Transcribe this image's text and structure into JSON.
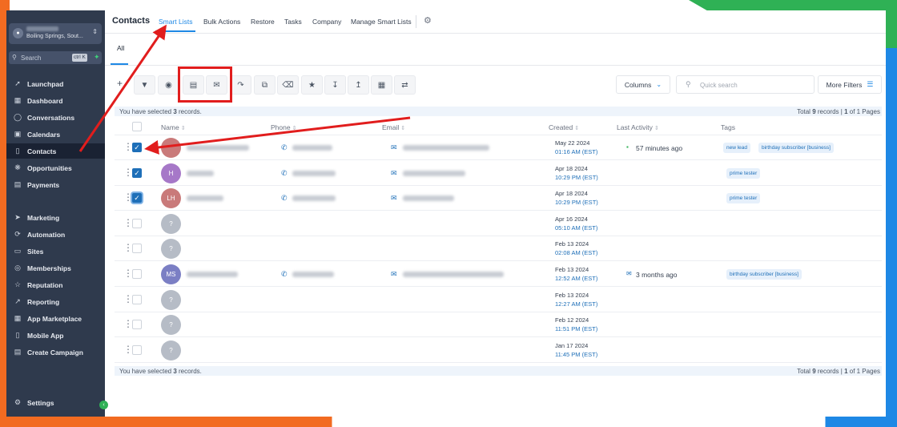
{
  "colors": {
    "accent": "#1e88e5",
    "sidebar": "#2f3a4d",
    "annotation": "#e11d1d"
  },
  "account": {
    "location": "Boiling Springs, Sout..."
  },
  "search": {
    "placeholder": "Search",
    "shortcut": "ctrl K"
  },
  "sidebar": {
    "items": [
      {
        "label": "Launchpad",
        "icon": "rocket-icon"
      },
      {
        "label": "Dashboard",
        "icon": "grid-icon"
      },
      {
        "label": "Conversations",
        "icon": "chat-icon"
      },
      {
        "label": "Calendars",
        "icon": "calendar-icon"
      },
      {
        "label": "Contacts",
        "icon": "contacts-icon"
      },
      {
        "label": "Opportunities",
        "icon": "opportunities-icon"
      },
      {
        "label": "Payments",
        "icon": "payments-icon"
      },
      {
        "label": "Marketing",
        "icon": "send-icon"
      },
      {
        "label": "Automation",
        "icon": "automation-icon"
      },
      {
        "label": "Sites",
        "icon": "sites-icon"
      },
      {
        "label": "Memberships",
        "icon": "memberships-icon"
      },
      {
        "label": "Reputation",
        "icon": "star-icon"
      },
      {
        "label": "Reporting",
        "icon": "chart-icon"
      },
      {
        "label": "App Marketplace",
        "icon": "apps-icon"
      },
      {
        "label": "Mobile App",
        "icon": "phone-icon"
      },
      {
        "label": "Create Campaign",
        "icon": "campaign-icon"
      }
    ],
    "settings": "Settings"
  },
  "header": {
    "title": "Contacts",
    "tabs": [
      "Smart Lists",
      "Bulk Actions",
      "Restore",
      "Tasks",
      "Company",
      "Manage Smart Lists"
    ]
  },
  "subtabs": {
    "all": "All"
  },
  "toolbar": {
    "icons": [
      "filter-icon",
      "robot-icon",
      "sms-icon",
      "email-icon",
      "export-icon",
      "duplicate-icon",
      "delete-icon",
      "star-icon",
      "download-icon",
      "upload-icon",
      "building-icon",
      "merge-icon"
    ],
    "columns": "Columns",
    "quick_search_placeholder": "Quick search",
    "more_filters": "More Filters"
  },
  "selection": {
    "prefix": "You have selected ",
    "count": "3",
    "suffix": " records.",
    "total_prefix": "Total ",
    "total": "9",
    "total_mid": " records | ",
    "page": "1",
    "page_suffix": " of 1 Pages"
  },
  "table": {
    "columns": [
      "Name",
      "Phone",
      "Email",
      "Created",
      "Last Activity",
      "Tags"
    ],
    "rows": [
      {
        "initials": "",
        "avatar_color": "#c97a7a",
        "checked": true,
        "has_phone": true,
        "has_email": true,
        "date": "May 22 2024",
        "time": "01:16 AM (EST)",
        "activity": "57 minutes ago",
        "activity_icon": "sms-icon",
        "tags": [
          "new lead",
          "birthday subscriber [business]"
        ]
      },
      {
        "initials": "H",
        "avatar_color": "#a678c8",
        "checked": true,
        "has_phone": true,
        "has_email": true,
        "date": "Apr 18 2024",
        "time": "10:29 PM (EST)",
        "activity": "",
        "activity_icon": "",
        "tags": [
          "prime tester"
        ]
      },
      {
        "initials": "LH",
        "avatar_color": "#c97a7a",
        "checked": true,
        "has_phone": true,
        "has_email": true,
        "date": "Apr 18 2024",
        "time": "10:29 PM (EST)",
        "activity": "",
        "activity_icon": "",
        "tags": [
          "prime tester"
        ]
      },
      {
        "initials": "?",
        "avatar_color": "#b6bcc6",
        "checked": false,
        "has_phone": false,
        "has_email": false,
        "date": "Apr 16 2024",
        "time": "05:10 AM (EST)",
        "activity": "",
        "activity_icon": "",
        "tags": []
      },
      {
        "initials": "?",
        "avatar_color": "#b6bcc6",
        "checked": false,
        "has_phone": false,
        "has_email": false,
        "date": "Feb 13 2024",
        "time": "02:08 AM (EST)",
        "activity": "",
        "activity_icon": "",
        "tags": []
      },
      {
        "initials": "MS",
        "avatar_color": "#7b7fc4",
        "checked": false,
        "has_phone": true,
        "has_email": true,
        "date": "Feb 13 2024",
        "time": "12:52 AM (EST)",
        "activity": "3 months ago",
        "activity_icon": "email-icon",
        "tags": [
          "birthday subscriber [business]"
        ]
      },
      {
        "initials": "?",
        "avatar_color": "#b6bcc6",
        "checked": false,
        "has_phone": false,
        "has_email": false,
        "date": "Feb 13 2024",
        "time": "12:27 AM (EST)",
        "activity": "",
        "activity_icon": "",
        "tags": []
      },
      {
        "initials": "?",
        "avatar_color": "#b6bcc6",
        "checked": false,
        "has_phone": false,
        "has_email": false,
        "date": "Feb 12 2024",
        "time": "11:51 PM (EST)",
        "activity": "",
        "activity_icon": "",
        "tags": []
      },
      {
        "initials": "?",
        "avatar_color": "#b6bcc6",
        "checked": false,
        "has_phone": false,
        "has_email": false,
        "date": "Jan 17 2024",
        "time": "11:45 PM (EST)",
        "activity": "",
        "activity_icon": "",
        "tags": []
      }
    ]
  }
}
